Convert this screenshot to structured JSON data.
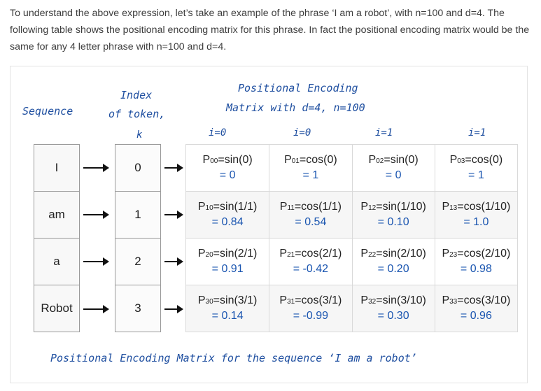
{
  "intro": "To understand the above expression, let’s take an example of the phrase ‘I am a robot’, with n=100 and d=4. The following table shows the positional encoding matrix for this phrase. In fact the positional encoding matrix would be the same for any 4 letter phrase with n=100 and d=4.",
  "figure": {
    "sequence_header": "Sequence",
    "index_header_line1": "Index",
    "index_header_line2": "of token,",
    "index_header_k": "k",
    "pe_header_line1": "Positional Encoding",
    "pe_header_line2": "Matrix with d=4, n=100",
    "column_i_labels": [
      "i=0",
      "i=0",
      "i=1",
      "i=1"
    ],
    "sequence": [
      "I",
      "am",
      "a",
      "Robot"
    ],
    "indices": [
      "0",
      "1",
      "2",
      "3"
    ],
    "matrix": [
      [
        {
          "p": "P",
          "sub": "00",
          "expr": "=sin(0)",
          "val": "= 0"
        },
        {
          "p": "P",
          "sub": "01",
          "expr": "=cos(0)",
          "val": "= 1"
        },
        {
          "p": "P",
          "sub": "02",
          "expr": "=sin(0)",
          "val": "= 0"
        },
        {
          "p": "P",
          "sub": "03",
          "expr": "=cos(0)",
          "val": "= 1"
        }
      ],
      [
        {
          "p": "P",
          "sub": "10",
          "expr": "=sin(1/1)",
          "val": "= 0.84"
        },
        {
          "p": "P",
          "sub": "11",
          "expr": "=cos(1/1)",
          "val": "= 0.54"
        },
        {
          "p": "P",
          "sub": "12",
          "expr": "=sin(1/10)",
          "val": "= 0.10"
        },
        {
          "p": "P",
          "sub": "13",
          "expr": "=cos(1/10)",
          "val": "= 1.0"
        }
      ],
      [
        {
          "p": "P",
          "sub": "20",
          "expr": "=sin(2/1)",
          "val": "= 0.91"
        },
        {
          "p": "P",
          "sub": "21",
          "expr": "=cos(2/1)",
          "val": "= -0.42"
        },
        {
          "p": "P",
          "sub": "22",
          "expr": "=sin(2/10)",
          "val": "= 0.20"
        },
        {
          "p": "P",
          "sub": "23",
          "expr": "=cos(2/10)",
          "val": "= 0.98"
        }
      ],
      [
        {
          "p": "P",
          "sub": "30",
          "expr": "=sin(3/1)",
          "val": "= 0.14"
        },
        {
          "p": "P",
          "sub": "31",
          "expr": "=cos(3/1)",
          "val": "= -0.99"
        },
        {
          "p": "P",
          "sub": "32",
          "expr": "=sin(3/10)",
          "val": "= 0.30"
        },
        {
          "p": "P",
          "sub": "33",
          "expr": "=cos(3/10)",
          "val": "= 0.96"
        }
      ]
    ],
    "caption": "Positional Encoding Matrix for the sequence ‘I am a robot’"
  }
}
